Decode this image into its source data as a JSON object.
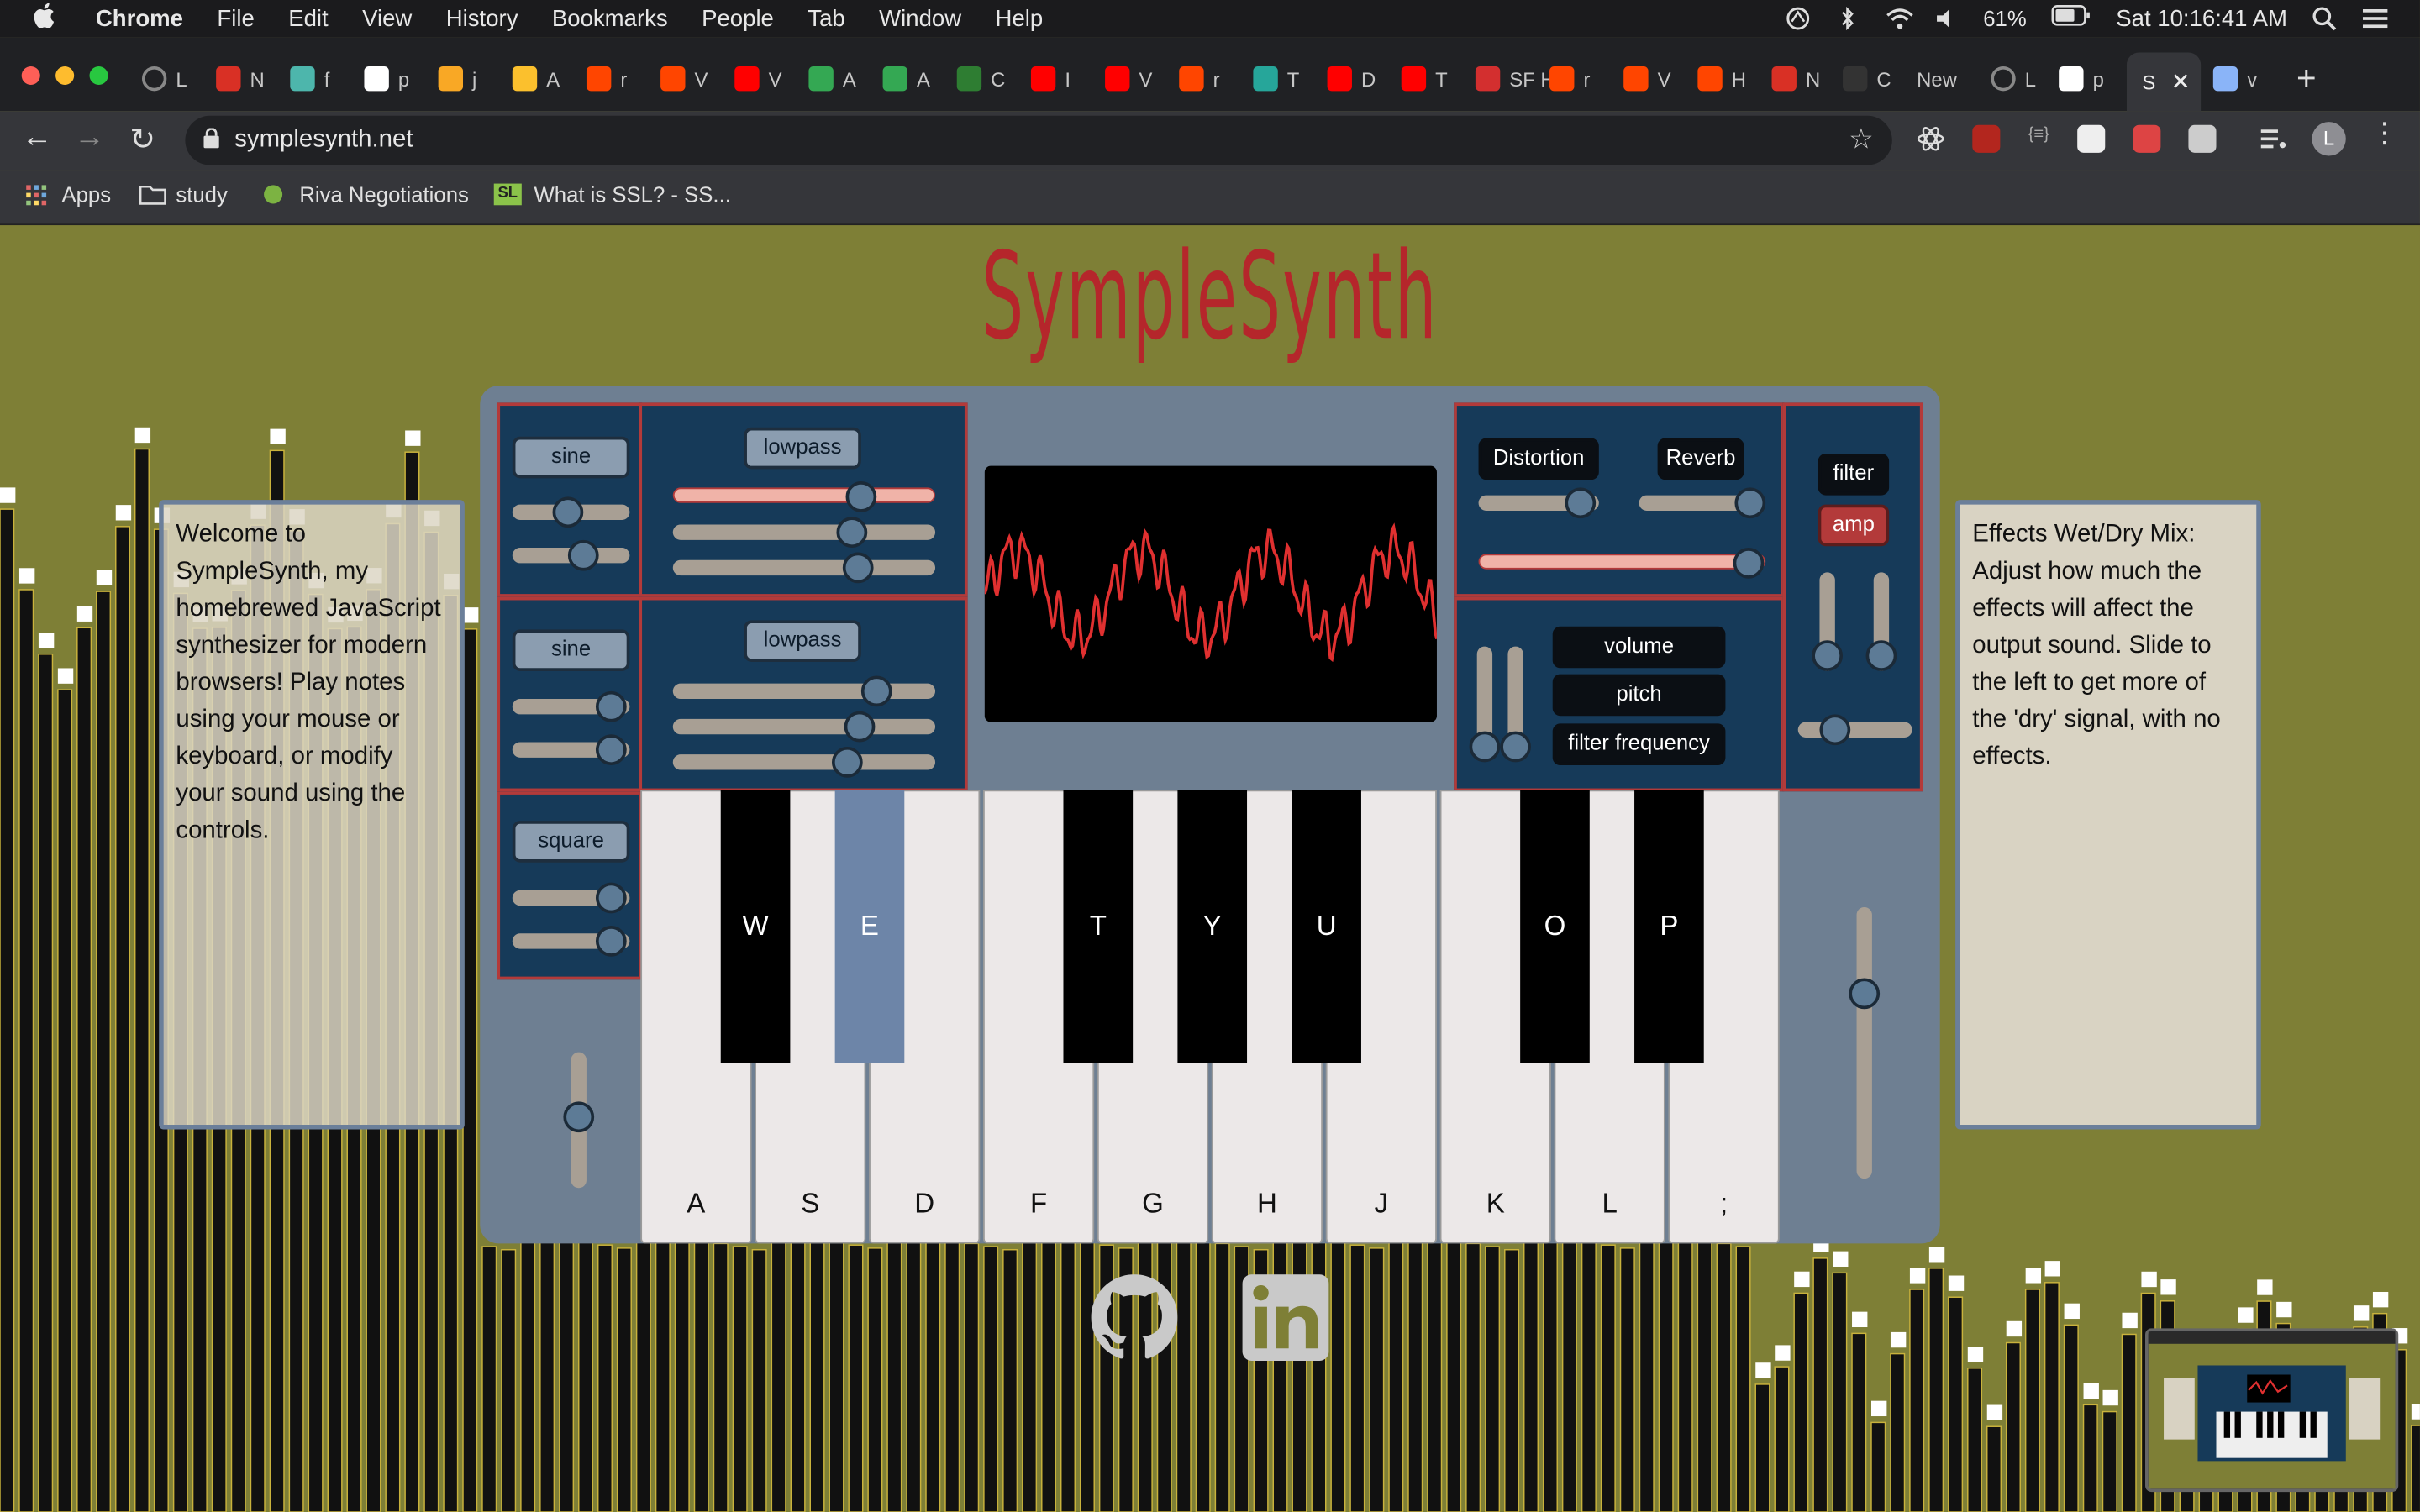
{
  "menubar": {
    "app": "Chrome",
    "menus": [
      "File",
      "Edit",
      "View",
      "History",
      "Bookmarks",
      "People",
      "Tab",
      "Window",
      "Help"
    ],
    "battery": "61%",
    "clock": "Sat 10:16:41 AM"
  },
  "tabs": [
    {
      "label": "L"
    },
    {
      "label": "N"
    },
    {
      "label": "f"
    },
    {
      "label": "p"
    },
    {
      "label": "j"
    },
    {
      "label": "A"
    },
    {
      "label": "r"
    },
    {
      "label": "V"
    },
    {
      "label": "V"
    },
    {
      "label": "A"
    },
    {
      "label": "A"
    },
    {
      "label": "C"
    },
    {
      "label": "I"
    },
    {
      "label": "V"
    },
    {
      "label": "r"
    },
    {
      "label": "T"
    },
    {
      "label": "D"
    },
    {
      "label": "T"
    },
    {
      "label": "SF H"
    },
    {
      "label": "r"
    },
    {
      "label": "V"
    },
    {
      "label": "H"
    },
    {
      "label": "N"
    },
    {
      "label": "C"
    },
    {
      "label": "New"
    },
    {
      "label": "L"
    },
    {
      "label": "p"
    },
    {
      "label": "S"
    },
    {
      "label": "v"
    }
  ],
  "address_bar": {
    "url": "symplesynth.net"
  },
  "bookmarks": [
    {
      "label": "Apps"
    },
    {
      "label": "study"
    },
    {
      "label": "Riva Negotiations"
    },
    {
      "label": "What is SSL? - SS..."
    }
  ],
  "page": {
    "title": "SympleSynth",
    "welcome_text": "Welcome to SympleSynth, my homebrewed JavaScript synthesizer for modern browsers! Play notes using your mouse or keyboard, or modify your sound using the controls.",
    "help_text": "Effects Wet/Dry Mix: Adjust how much the effects will affect the output sound. Slide to the left to get more of the 'dry' signal, with no effects."
  },
  "synth": {
    "oscillators": [
      {
        "wave": "sine",
        "sliders": [
          0.48,
          0.6
        ]
      },
      {
        "wave": "sine",
        "sliders": [
          0.82,
          0.82
        ]
      },
      {
        "wave": "square",
        "sliders": [
          0.82,
          0.82
        ]
      }
    ],
    "filters": [
      {
        "type": "lowpass",
        "sliders": [
          0.72,
          0.69,
          0.72
        ]
      },
      {
        "type": "lowpass",
        "sliders": [
          0.79,
          0.72,
          0.67
        ]
      }
    ],
    "effects": {
      "distortion_label": "Distortion",
      "reverb_label": "Reverb",
      "distortion": 0.78,
      "reverb": 0.83,
      "wet_dry": 0.98
    },
    "lfo_targets": [
      "volume",
      "pitch",
      "filter frequency"
    ],
    "envelope_tabs": [
      "filter",
      "amp"
    ],
    "white_keys": [
      "A",
      "S",
      "D",
      "F",
      "G",
      "H",
      "J",
      "K",
      "L",
      ";"
    ],
    "black_keys": [
      {
        "label": "W",
        "pos": 0
      },
      {
        "label": "E",
        "pos": 1,
        "active": true
      },
      {
        "label": "T",
        "pos": 3
      },
      {
        "label": "Y",
        "pos": 4
      },
      {
        "label": "U",
        "pos": 5
      },
      {
        "label": "O",
        "pos": 7
      },
      {
        "label": "P",
        "pos": 8
      }
    ]
  },
  "colors": {
    "background": "#7e7f36",
    "accent": "#b5262b",
    "panel": "#163a59",
    "wave": "#e03030"
  }
}
